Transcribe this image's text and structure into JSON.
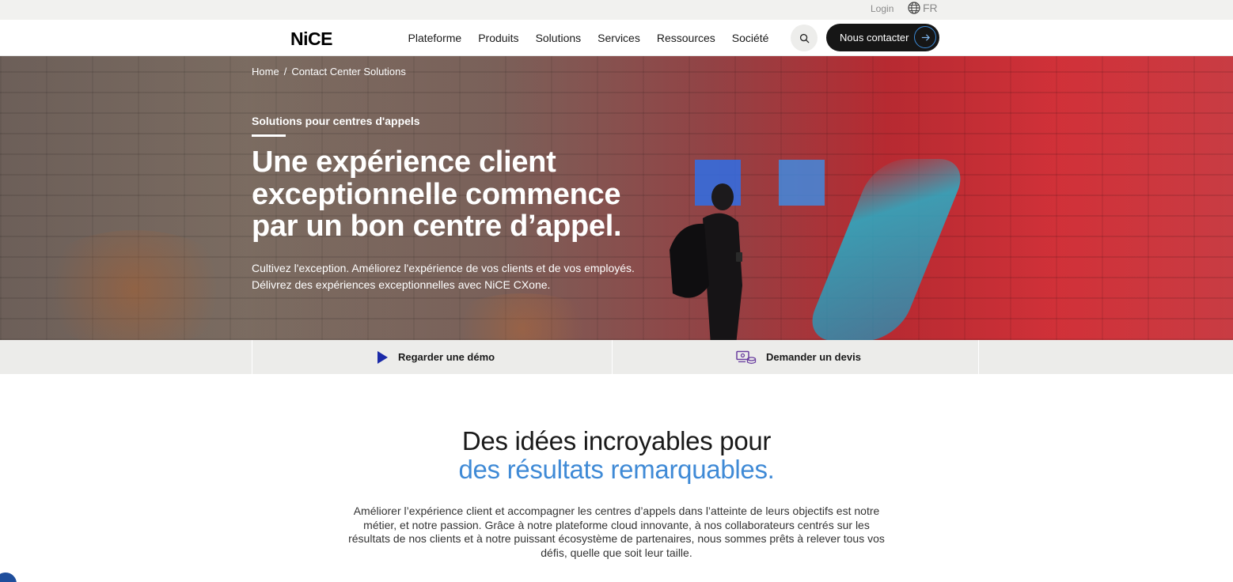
{
  "utility": {
    "login_label": "Login",
    "language_label": "FR"
  },
  "header": {
    "logo_text": "NiCE",
    "nav": [
      {
        "label": "Plateforme"
      },
      {
        "label": "Produits"
      },
      {
        "label": "Solutions"
      },
      {
        "label": "Services"
      },
      {
        "label": "Ressources"
      },
      {
        "label": "Société"
      }
    ],
    "contact_label": "Nous contacter"
  },
  "hero": {
    "breadcrumb": {
      "home": "Home",
      "separator": "/",
      "current": "Contact Center Solutions"
    },
    "eyebrow": "Solutions pour centres d'appels",
    "title": "Une expérience client exceptionnelle commence par un bon centre d’appel.",
    "subtitle": "Cultivez l'exception. Améliorez l'expérience de vos clients et de vos employés. Délivrez des expériences exceptionnelles avec NiCE CXone."
  },
  "cta_bar": {
    "demo_label": "Regarder une démo",
    "quote_label": "Demander un devis"
  },
  "intro": {
    "title_line1": "Des idées incroyables pour",
    "title_line2": "des résultats remarquables.",
    "body": "Améliorer l’expérience client et accompagner les centres d’appels dans l’atteinte de leurs objectifs est notre métier, et notre passion. Grâce à notre plateforme cloud innovante, à nos collaborateurs centrés sur les résultats de nos clients et à notre puissant écosystème de partenaires, nous sommes prêts à relever tous vos défis, quelle que soit leur taille."
  },
  "colors": {
    "accent_blue": "#3f8ad6",
    "dark_button": "#161616",
    "play_icon": "#1b2aa8"
  },
  "icons": [
    "globe-icon",
    "search-icon",
    "arrow-right-icon",
    "play-icon",
    "quote-icon",
    "accessibility-icon"
  ]
}
